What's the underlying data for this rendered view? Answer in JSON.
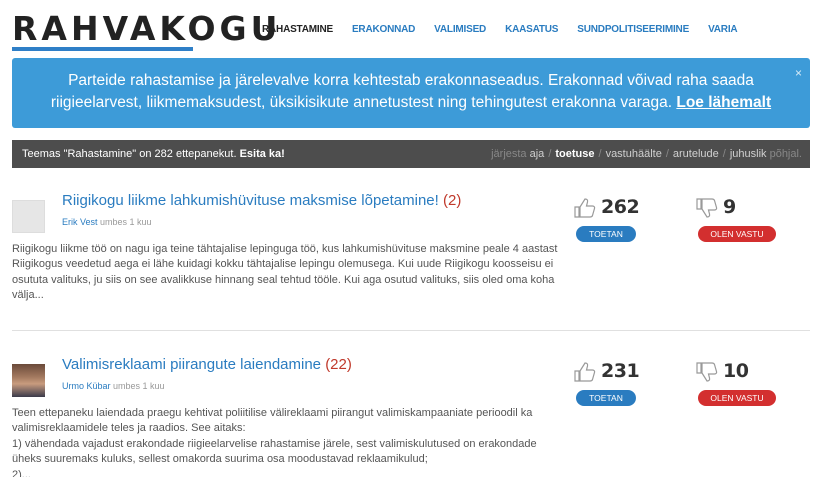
{
  "header": {
    "logo": "RAHVAKOGU",
    "nav": [
      {
        "label": "RAHASTAMINE",
        "active": true
      },
      {
        "label": "ERAKONNAD",
        "active": false
      },
      {
        "label": "VALIMISED",
        "active": false
      },
      {
        "label": "KAASATUS",
        "active": false
      },
      {
        "label": "SUNDPOLITISEERIMINE",
        "active": false
      },
      {
        "label": "VARIA",
        "active": false
      }
    ]
  },
  "banner": {
    "text": "Parteide rahastamise ja järelevalve korra kehtestab erakonnaseadus. Erakonnad võivad raha saada riigieelarvest, liikmemaksudest, üksikisikute annetustest ning tehingutest erakonna varaga.",
    "link": "Loe lähemalt",
    "close": "×"
  },
  "filter": {
    "summary": "Teemas \"Rahastamine\" on 282 ettepanekut.",
    "cta": "Esita ka!",
    "sort_lead": "järjesta",
    "sort_options": [
      "aja",
      "toetuse",
      "vastuhäälte",
      "arutelude",
      "juhuslik"
    ],
    "sort_active": "toetuse",
    "sort_tail": "põhjal."
  },
  "proposals": [
    {
      "title": "Riigikogu liikme lahkumishüvituse maksmise lõpetamine!",
      "comments": "(2)",
      "author": "Erik Vest",
      "time": "umbes 1 kuu",
      "body": "Riigikogu liikme töö on nagu iga teine tähtajalise lepinguga töö, kus lahkumishüvituse maksmine peale 4 aastast Riigikogus veedetud aega ei lähe kuidagi kokku tähtajalise lepingu olemusega. Kui uude Riigikogu koosseisu ei osututa valituks, ju siis on see avalikkuse hinnang seal tehtud tööle. Kui aga osutud valituks, siis oled oma koha välja...",
      "up": "262",
      "down": "9",
      "up_label": "TOETAN",
      "down_label": "OLEN VASTU"
    },
    {
      "title": "Valimisreklaami piirangute laiendamine",
      "comments": "(22)",
      "author": "Urmo Kübar",
      "time": "umbes 1 kuu",
      "body": "Teen ettepaneku laiendada praegu kehtivat poliitilise välireklaami piirangut valimiskampaaniate perioodil ka valimisreklaamidele teles ja raadios. See aitaks:\n1) vähendada vajadust erakondade riigieelarvelise rahastamise järele, sest valimiskulutused on erakondade üheks suuremaks kuluks, sellest omakorda suurima osa moodustavad reklaamikulud;\n2)...",
      "up": "231",
      "down": "10",
      "up_label": "TOETAN",
      "down_label": "OLEN VASTU"
    }
  ],
  "colors": {
    "brand_blue": "#2a7cc0",
    "banner_bg": "#3d9bd8",
    "filter_bg": "#4d4d4d",
    "accent_red": "#d32f2f",
    "comment_red": "#c0392b"
  }
}
